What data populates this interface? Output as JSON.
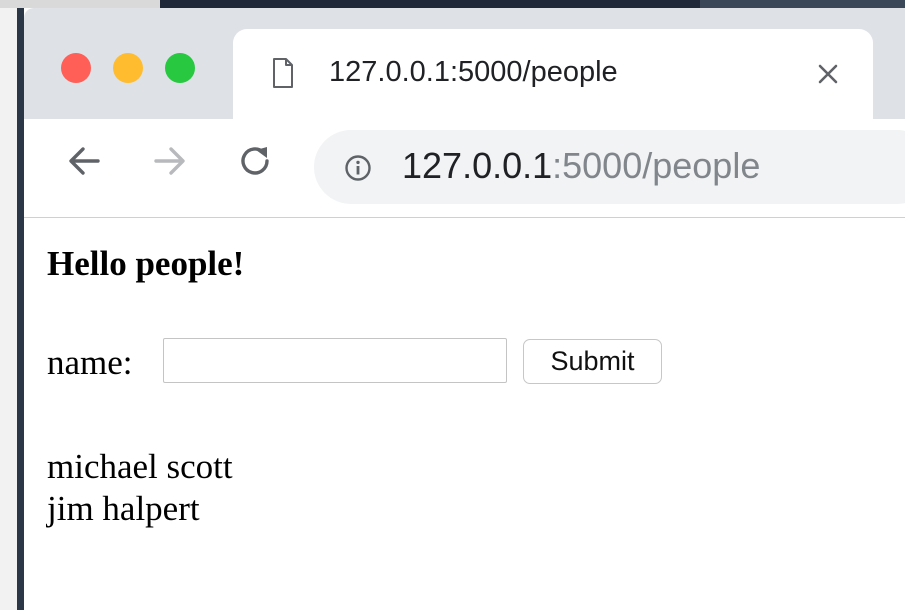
{
  "browser": {
    "tab": {
      "title": "127.0.0.1:5000/people"
    },
    "address_bar": {
      "host": "127.0.0.1",
      "rest": ":5000/people"
    }
  },
  "icons": {
    "tab_favicon": "page-icon",
    "tab_close": "close-icon",
    "back": "arrow-left-icon",
    "forward": "arrow-right-icon",
    "reload": "reload-icon",
    "site_info": "info-icon"
  },
  "colors": {
    "traffic_red": "#ff5f57",
    "traffic_yellow": "#febc2e",
    "traffic_green": "#28c840",
    "chrome_frame": "#dee1e6",
    "omnibox_bg": "#f1f3f4"
  },
  "page": {
    "heading": "Hello people!",
    "form": {
      "label": "name:",
      "input_value": "",
      "submit_label": "Submit"
    },
    "people": [
      "michael scott",
      "jim halpert"
    ]
  }
}
